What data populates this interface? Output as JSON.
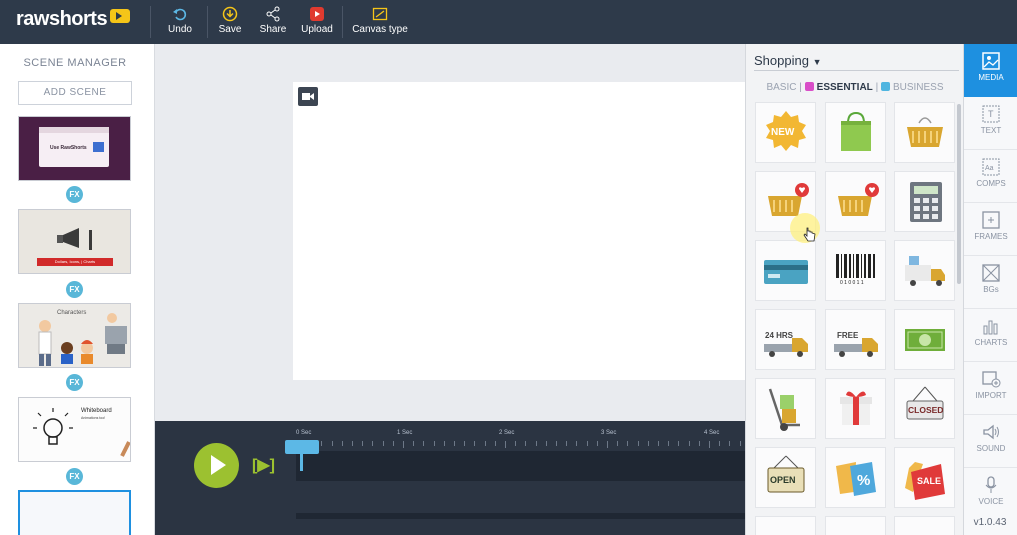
{
  "app": {
    "logo_text": "rawshorts",
    "version": "v1.0.43"
  },
  "toolbar": {
    "undo_label": "Undo",
    "save_label": "Save",
    "share_label": "Share",
    "upload_label": "Upload",
    "canvas_type_label": "Canvas type"
  },
  "scene_manager": {
    "title": "SCENE MANAGER",
    "add_scene_label": "ADD SCENE",
    "fx_label": "FX",
    "scenes": [
      {
        "caption": "Use RawShorts"
      },
      {
        "caption": "Dollars, Icons, | Charts"
      },
      {
        "caption": "Characters"
      },
      {
        "caption": "Whiteboard",
        "subcaption": "Animations too!"
      }
    ]
  },
  "timeline": {
    "step_label": "[▶]",
    "ruler_labels": [
      "0 Sec",
      "1 Sec",
      "2 Sec",
      "3 Sec",
      "4 Sec"
    ]
  },
  "media_panel": {
    "category": "Shopping",
    "tiers": {
      "basic": "BASIC",
      "essential": "ESSENTIAL",
      "business": "BUSINESS"
    },
    "items": [
      {
        "name": "new-badge",
        "text": "NEW"
      },
      {
        "name": "shopping-bag"
      },
      {
        "name": "shopping-basket"
      },
      {
        "name": "basket-heart"
      },
      {
        "name": "basket-heart-2"
      },
      {
        "name": "calculator"
      },
      {
        "name": "credit-card"
      },
      {
        "name": "barcode",
        "text": "0 1 0 0 1 1"
      },
      {
        "name": "delivery-truck"
      },
      {
        "name": "truck-24hrs",
        "text": "24 HRS"
      },
      {
        "name": "truck-free",
        "text": "FREE"
      },
      {
        "name": "cash"
      },
      {
        "name": "hand-truck"
      },
      {
        "name": "gift-box"
      },
      {
        "name": "closed-sign",
        "text": "CLOSED"
      },
      {
        "name": "open-sign",
        "text": "OPEN"
      },
      {
        "name": "percent-tag",
        "text": "%"
      },
      {
        "name": "sale-tag",
        "text": "SALE"
      }
    ]
  },
  "right_nav": {
    "items": [
      {
        "label": "MEDIA",
        "active": true
      },
      {
        "label": "TEXT"
      },
      {
        "label": "COMPS"
      },
      {
        "label": "FRAMES"
      },
      {
        "label": "BGs"
      },
      {
        "label": "CHARTS"
      },
      {
        "label": "IMPORT"
      },
      {
        "label": "SOUND"
      },
      {
        "label": "VOICE"
      }
    ]
  },
  "colors": {
    "topbar": "#2e3a4a",
    "accent_blue": "#1e90e0",
    "play_green": "#9cc130",
    "fx_blue": "#59b7d8"
  }
}
